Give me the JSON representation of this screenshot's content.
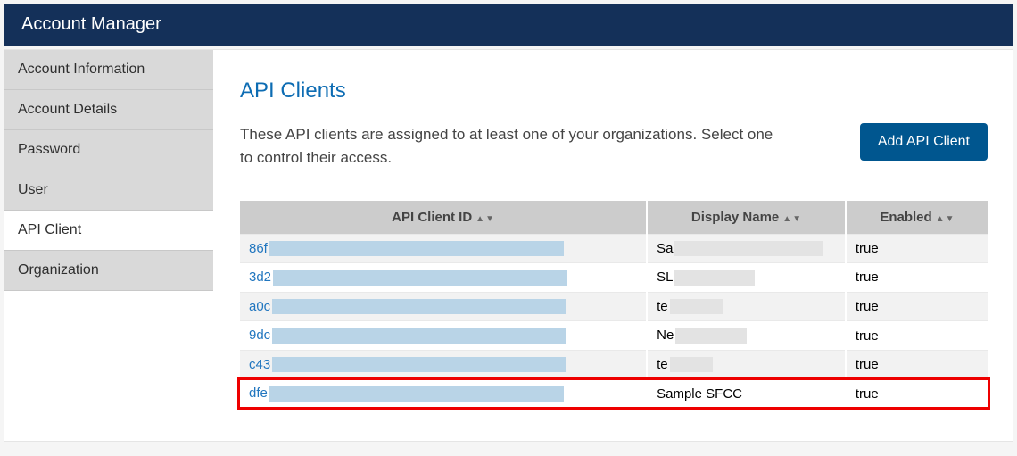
{
  "header": {
    "title": "Account Manager"
  },
  "sidebar": {
    "items": [
      {
        "label": "Account Information"
      },
      {
        "label": "Account Details"
      },
      {
        "label": "Password"
      },
      {
        "label": "User"
      },
      {
        "label": "API Client"
      },
      {
        "label": "Organization"
      }
    ],
    "active_index": 4
  },
  "page": {
    "title": "API Clients",
    "description": "These API clients are assigned to at least one of your organizations. Select one to control their access.",
    "add_button": "Add API Client"
  },
  "table": {
    "columns": [
      {
        "label": "API Client ID"
      },
      {
        "label": "Display Name"
      },
      {
        "label": "Enabled"
      }
    ],
    "rows": [
      {
        "id_prefix": "86f",
        "id_redact_w": 330,
        "display_prefix": "Sa",
        "display_redact_w": 166,
        "enabled": "true"
      },
      {
        "id_prefix": "3d2",
        "id_redact_w": 330,
        "display_prefix": "SL",
        "display_redact_w": 90,
        "enabled": "true"
      },
      {
        "id_prefix": "a0c",
        "id_redact_w": 330,
        "display_prefix": "te",
        "display_redact_w": 60,
        "enabled": "true"
      },
      {
        "id_prefix": "9dc",
        "id_redact_w": 330,
        "display_prefix": "Ne",
        "display_redact_w": 80,
        "enabled": "true"
      },
      {
        "id_prefix": "c43",
        "id_redact_w": 330,
        "display_prefix": "te",
        "display_redact_w": 48,
        "enabled": "true"
      },
      {
        "id_prefix": "dfe",
        "id_redact_w": 330,
        "display_prefix": "Sample SFCC",
        "display_redact_w": 0,
        "enabled": "true"
      }
    ],
    "highlight_index": 5
  }
}
